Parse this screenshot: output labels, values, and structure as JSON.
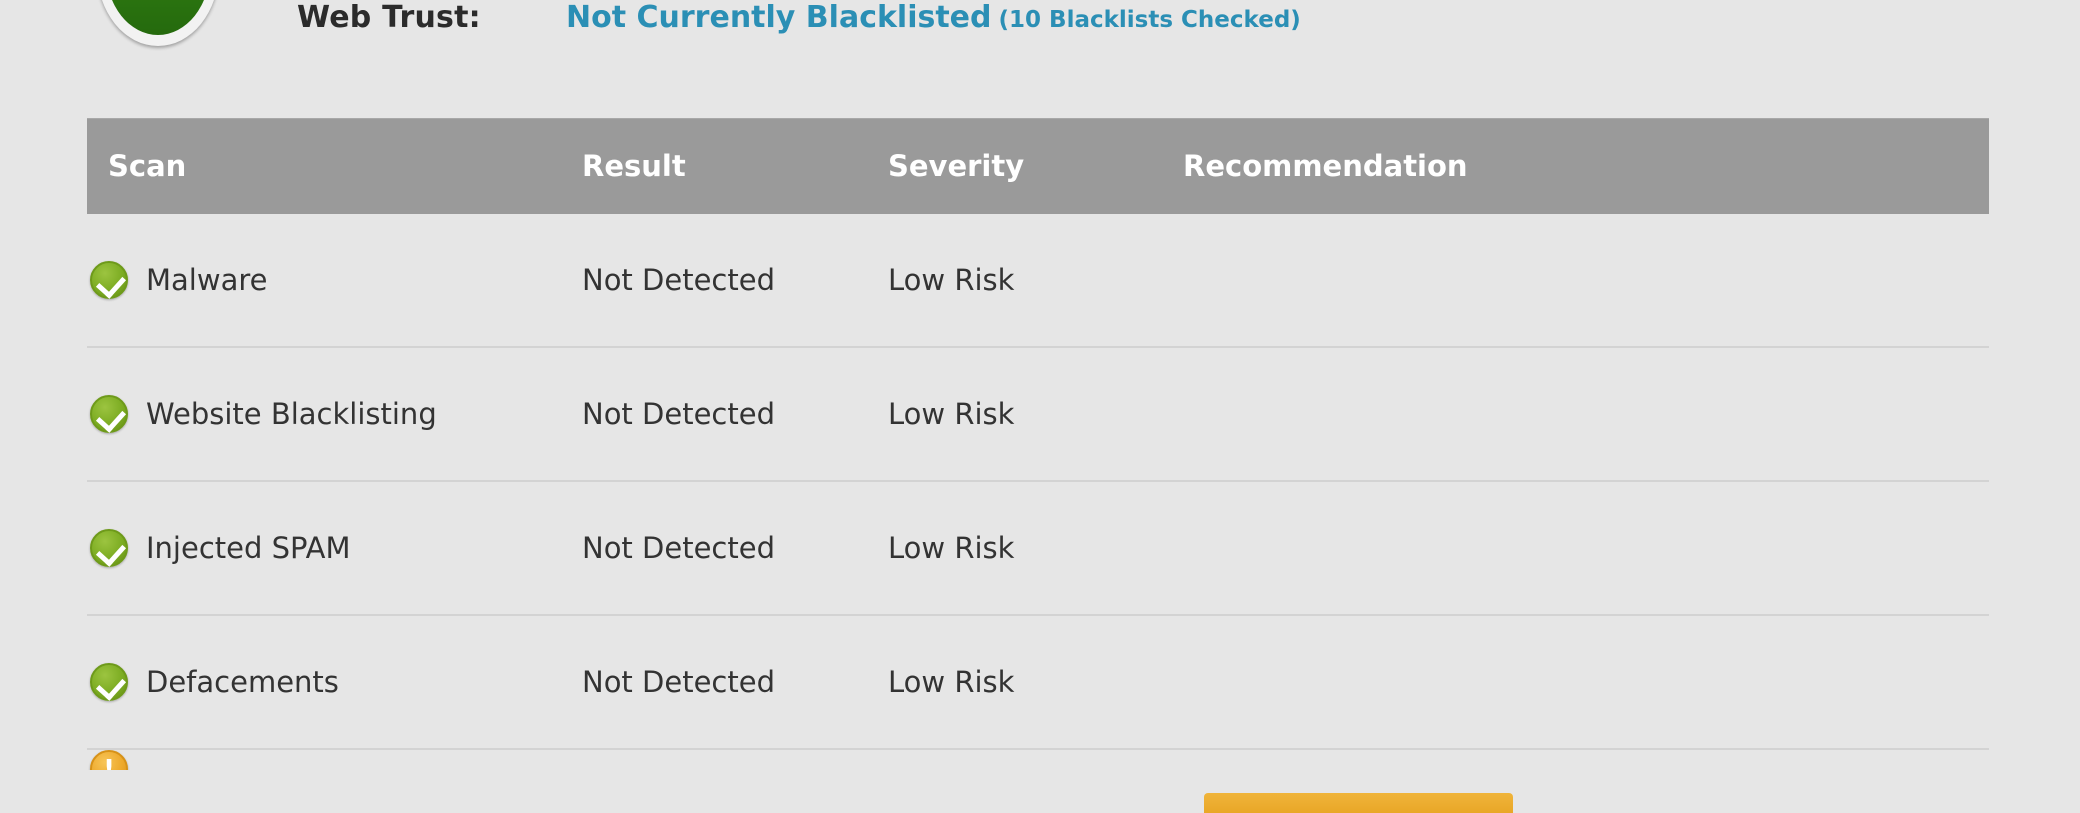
{
  "trust": {
    "shield_icon": "green-shield-icon",
    "label": "Web Trust:",
    "status": "Not Currently Blacklisted",
    "blacklists_checked": "(10 Blacklists Checked)",
    "status_color": "#2b8fb5",
    "label_color": "#2b2b2b"
  },
  "table": {
    "header_bg": "#9a9a9a",
    "columns": [
      {
        "key": "scan",
        "label": "Scan"
      },
      {
        "key": "result",
        "label": "Result"
      },
      {
        "key": "severity",
        "label": "Severity"
      },
      {
        "key": "recommendation",
        "label": "Recommendation"
      }
    ],
    "rows": [
      {
        "icon": "green-check-icon",
        "icon_state": "ok",
        "scan": "Malware",
        "result": "Not Detected",
        "severity": "Low Risk",
        "recommendation": ""
      },
      {
        "icon": "green-check-icon",
        "icon_state": "ok",
        "scan": "Website Blacklisting",
        "result": "Not Detected",
        "severity": "Low Risk",
        "recommendation": ""
      },
      {
        "icon": "green-check-icon",
        "icon_state": "ok",
        "scan": "Injected SPAM",
        "result": "Not Detected",
        "severity": "Low Risk",
        "recommendation": ""
      },
      {
        "icon": "green-check-icon",
        "icon_state": "ok",
        "scan": "Defacements",
        "result": "Not Detected",
        "severity": "Low Risk",
        "recommendation": ""
      },
      {
        "icon": "amber-warning-icon",
        "icon_state": "warn",
        "scan": "",
        "result": "",
        "severity": "",
        "recommendation": ""
      }
    ]
  },
  "action_button": {
    "label": "",
    "color": "#e9a727"
  },
  "colors": {
    "page_background": "#e6e6e6",
    "row_divider": "#d3d3d3",
    "ok_green": "#7cac22",
    "shield_green": "#2b7510",
    "warn_amber": "#eda92c"
  }
}
